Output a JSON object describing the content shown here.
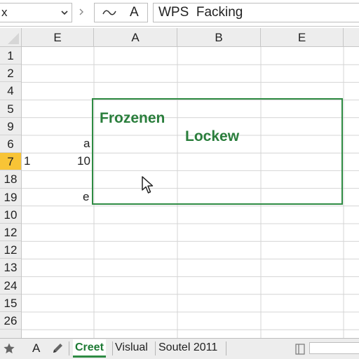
{
  "formula_bar": {
    "name_box_value": "x",
    "fx_wave_symbol": "~",
    "fx_letter": "A",
    "formula_text": "WPS  Facking"
  },
  "columns": [
    "E",
    "A",
    "B",
    "E"
  ],
  "rows": [
    "1",
    "2",
    "4",
    "5",
    "9",
    "6",
    "7",
    "18",
    "19",
    "10",
    "12",
    "12",
    "13",
    "24",
    "15",
    "26"
  ],
  "selected_row": "7",
  "cells": {
    "row6_e": "a",
    "row7_col_left": "1",
    "row7_e": "10",
    "row19_e": "e"
  },
  "frozen_region": {
    "label_frozen": "Frozenen",
    "label_locked": "Lockew",
    "accent_color": "#2e8b43"
  },
  "sheet_tabs": {
    "left_letter": "A",
    "tabs": [
      "Creet",
      "Vislual",
      "Soutel 2011"
    ],
    "active_tab": "Creet"
  },
  "colors": {
    "selected_row_header": "#f8c436",
    "header_bg": "#ededed",
    "grid_line": "#d4d4d4",
    "accent_green": "#2e8b43"
  }
}
